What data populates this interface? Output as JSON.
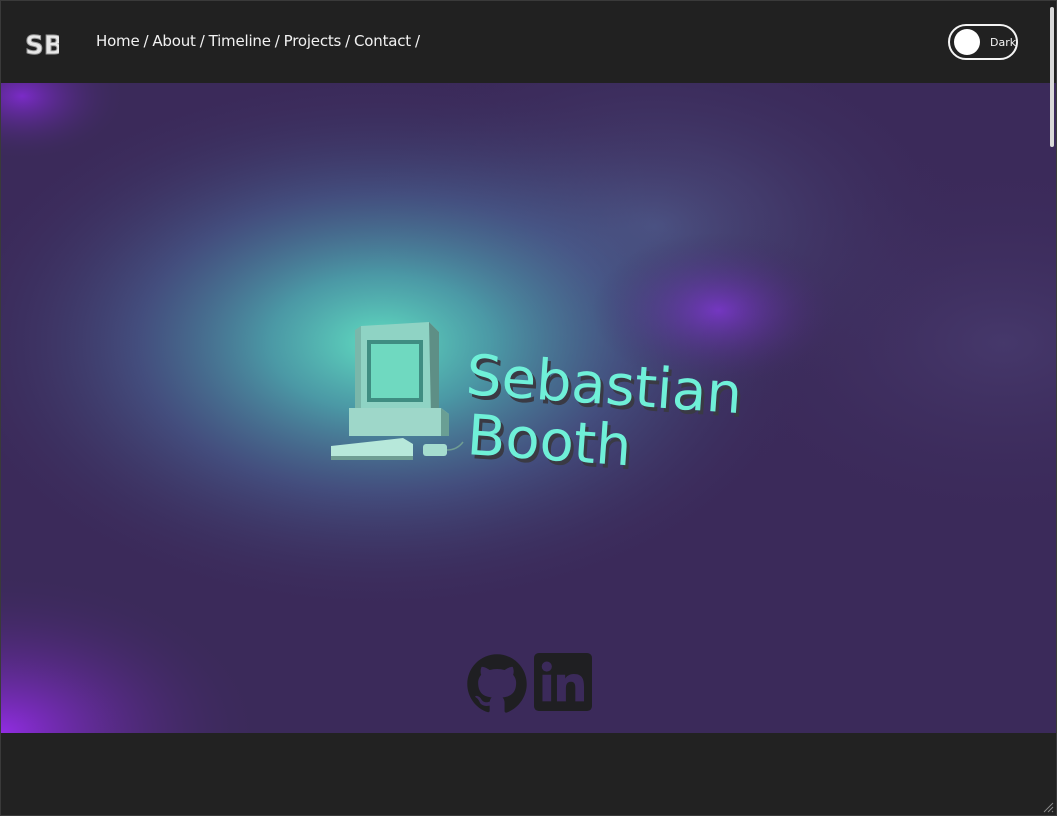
{
  "header": {
    "logo_text": "SB",
    "nav": [
      {
        "label": "Home"
      },
      {
        "label": "About"
      },
      {
        "label": "Timeline"
      },
      {
        "label": "Projects"
      },
      {
        "label": "Contact"
      }
    ],
    "separator": "/",
    "theme_toggle": {
      "label": "Dark",
      "state": "dark"
    }
  },
  "hero": {
    "name_line1": "Sebastian",
    "name_line2": "Booth",
    "computer_icon": "retro-computer-icon",
    "background_colors": {
      "base": "#3b2a5a",
      "glow": "#5fe3cc",
      "accent": "#8a2be2"
    },
    "social": [
      {
        "name": "github-icon"
      },
      {
        "name": "linkedin-icon"
      }
    ]
  },
  "colors": {
    "header_bg": "#212121",
    "footer_bg": "#222222",
    "title_text": "#6ff0d8",
    "title_shadow": "#3a3a44",
    "icon_dark": "#1f1f22"
  }
}
